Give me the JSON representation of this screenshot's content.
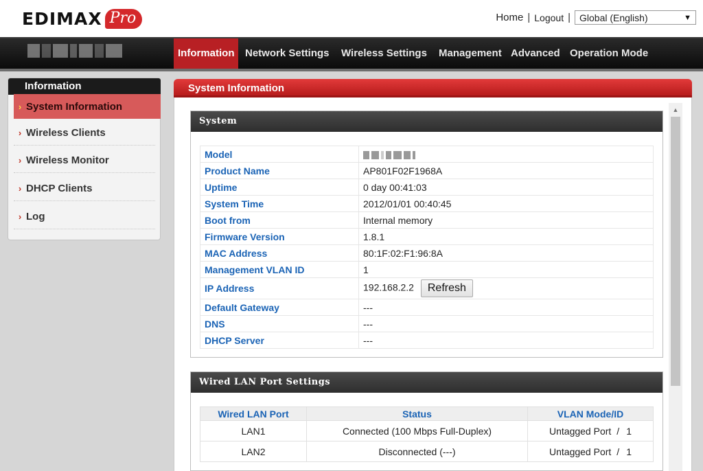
{
  "header": {
    "logo_text": "EDIMAX",
    "logo_badge": "Pro",
    "home_link": "Home",
    "separator": "|",
    "logout_link": "Logout",
    "language": "Global (English)"
  },
  "nav": {
    "items": [
      {
        "label": "Information"
      },
      {
        "label": "Network Settings"
      },
      {
        "label": "Wireless Settings"
      },
      {
        "label": "Management"
      },
      {
        "label": "Advanced"
      },
      {
        "label": "Operation Mode"
      }
    ]
  },
  "sidebar": {
    "title": "Information",
    "items": [
      {
        "label": "System Information"
      },
      {
        "label": "Wireless Clients"
      },
      {
        "label": "Wireless Monitor"
      },
      {
        "label": "DHCP Clients"
      },
      {
        "label": "Log"
      }
    ]
  },
  "main": {
    "panel_title": "System Information",
    "system": {
      "heading": "System",
      "rows": [
        {
          "key": "Model",
          "value": ""
        },
        {
          "key": "Product Name",
          "value": "AP801F02F1968A"
        },
        {
          "key": "Uptime",
          "value": " 0 day 00:41:03"
        },
        {
          "key": "System Time",
          "value": "2012/01/01 00:40:45"
        },
        {
          "key": "Boot from",
          "value": "Internal memory"
        },
        {
          "key": "Firmware Version",
          "value": "1.8.1"
        },
        {
          "key": "MAC Address",
          "value": "80:1F:02:F1:96:8A"
        },
        {
          "key": "Management VLAN ID",
          "value": "1"
        },
        {
          "key": "IP Address",
          "value": "192.168.2.2"
        },
        {
          "key": "Default Gateway",
          "value": "---"
        },
        {
          "key": "DNS",
          "value": "---"
        },
        {
          "key": "DHCP Server",
          "value": "---"
        }
      ],
      "refresh_label": "Refresh"
    },
    "wired_lan": {
      "heading": "Wired LAN Port Settings",
      "columns": [
        "Wired LAN Port",
        "Status",
        "VLAN Mode/ID"
      ],
      "rows": [
        {
          "port": "LAN1",
          "status": "Connected (100 Mbps Full-Duplex)",
          "mode": "Untagged Port",
          "sep": "/",
          "id": "1"
        },
        {
          "port": "LAN2",
          "status": "Disconnected (---)",
          "mode": "Untagged Port",
          "sep": "/",
          "id": "1"
        }
      ]
    }
  }
}
